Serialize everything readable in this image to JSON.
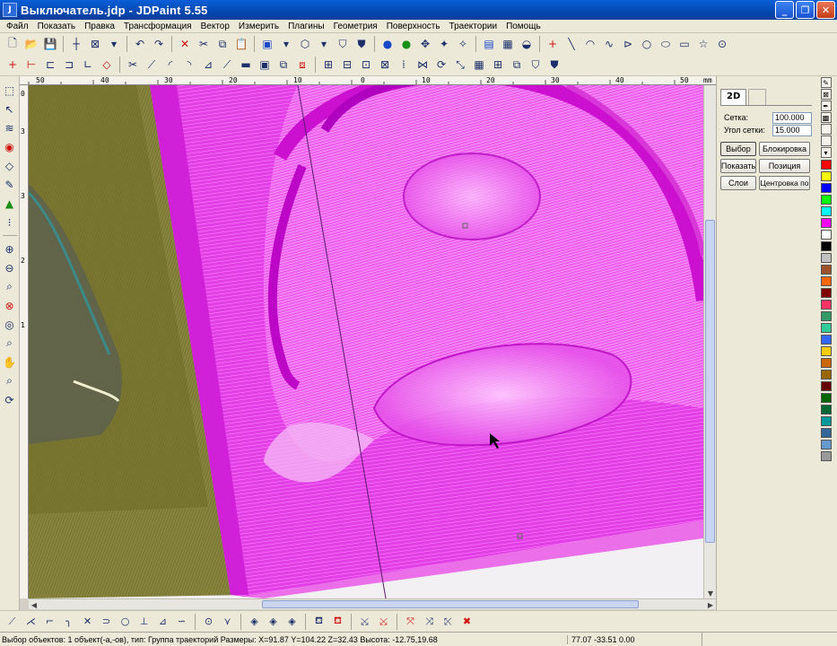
{
  "window": {
    "title": "Выключатель.jdp - JDPaint 5.55",
    "app_icon": "jdpaint-icon"
  },
  "menu": [
    "Файл",
    "Показать",
    "Правка",
    "Трансформация",
    "Вектор",
    "Измерить",
    "Плагины",
    "Геометрия",
    "Поверхность",
    "Траектории",
    "Помощь"
  ],
  "ruler_top": [
    "50",
    "40",
    "30",
    "20",
    "10",
    "0",
    "10",
    "20",
    "30",
    "40",
    "50",
    "mm"
  ],
  "ruler_left": [
    "0",
    "3",
    "3",
    "2",
    "1"
  ],
  "panel": {
    "tab_label": "2D",
    "grid_label": "Сетка:",
    "grid_value": "100.000",
    "angle_label": "Угол сетки:",
    "angle_value": "15.000",
    "buttons": [
      "Выбор",
      "Блокировка",
      "Показать",
      "Позиция",
      "Слои",
      "Центровка по"
    ]
  },
  "palette_colors": [
    "#ff0000",
    "#ffff00",
    "#0000ff",
    "#00ff00",
    "#00ffff",
    "#ff00ff",
    "#ffffff",
    "#000000",
    "#c0c0c0",
    "#a0522d",
    "#ff6600",
    "#800000",
    "#ff3366",
    "#339966",
    "#33cc99",
    "#3366ff",
    "#ffcc00",
    "#cc6600",
    "#996600",
    "#660000",
    "#006600",
    "#006633",
    "#009999",
    "#336699",
    "#6699cc",
    "#999999"
  ],
  "status": {
    "main": "Выбор объектов: 1 объект(-а,-ов), тип: Группа траекторий  Размеры: X=91.87  Y=104.22  Z=32.43  Высота: -12.75,19.68",
    "coords": "77.07 -33.51 0.00"
  }
}
